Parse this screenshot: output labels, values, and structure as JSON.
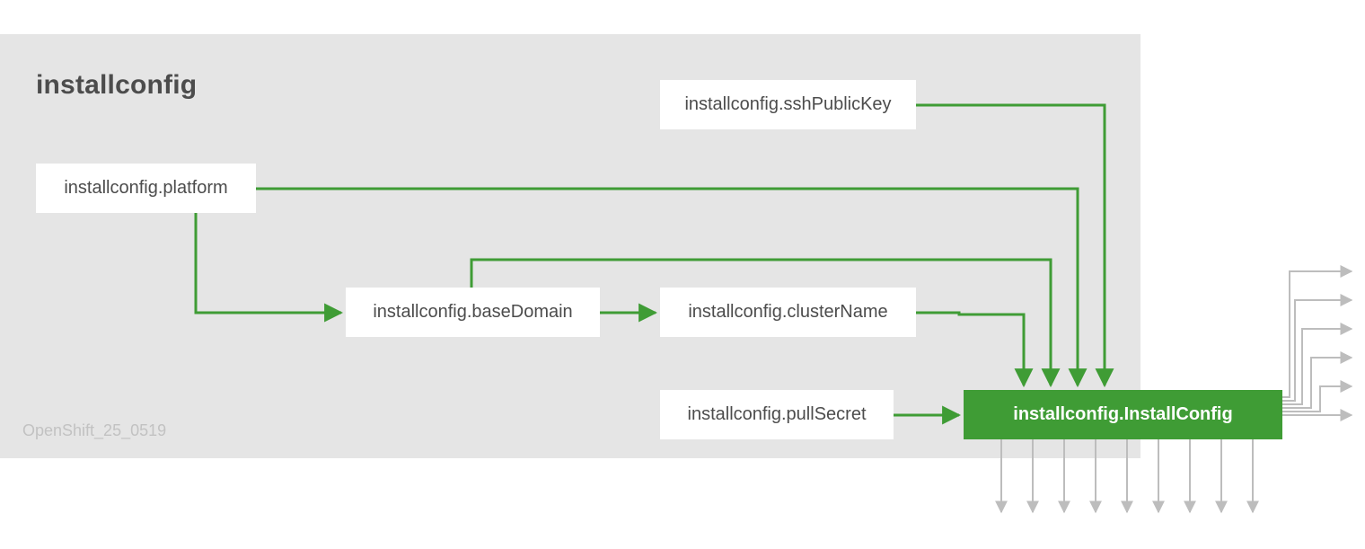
{
  "title": "installconfig",
  "watermark": "OpenShift_25_0519",
  "colors": {
    "green": "#3f9c35",
    "grey": "#bdbdbd",
    "panel": "#e5e5e5",
    "text": "#4c4c4c"
  },
  "nodes": {
    "sshPublicKey": "installconfig.sshPublicKey",
    "platform": "installconfig.platform",
    "baseDomain": "installconfig.baseDomain",
    "clusterName": "installconfig.clusterName",
    "pullSecret": "installconfig.pullSecret",
    "installConfig": "installconfig.InstallConfig"
  },
  "layout_note": "platform → baseDomain → clusterName chain; platform, sshPublicKey, baseDomain, clusterName, pullSecret all feed into InstallConfig. InstallConfig has ~9 grey fan-out arrows leaving the panel (to the right, curving down)."
}
